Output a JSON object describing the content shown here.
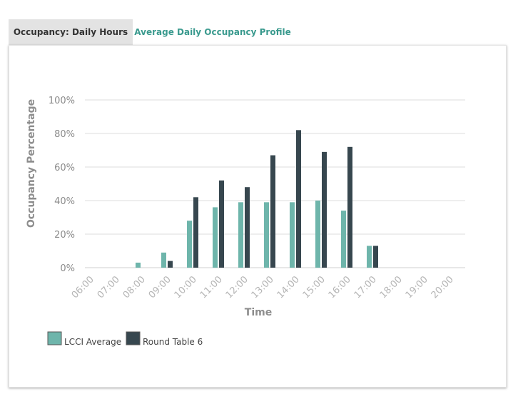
{
  "tabs": [
    {
      "label": "Occupancy: Daily Hours",
      "active": false
    },
    {
      "label": "Average Daily Occupancy Profile",
      "active": true
    }
  ],
  "colors": {
    "series_1": "#6eb5ab",
    "series_2": "#37474f",
    "grid": "#dddddd",
    "active_tab": "#3a9a8e"
  },
  "chart_data": {
    "type": "bar",
    "xlabel": "Time",
    "ylabel": "Occupancy Percentage",
    "categories": [
      "06:00",
      "07:00",
      "08:00",
      "09:00",
      "10:00",
      "11:00",
      "12:00",
      "13:00",
      "14:00",
      "15:00",
      "16:00",
      "17:00",
      "18:00",
      "19:00",
      "20:00"
    ],
    "yticks": [
      "0%",
      "20%",
      "40%",
      "60%",
      "80%",
      "100%"
    ],
    "ylim": [
      0,
      100
    ],
    "grid": true,
    "legend_position": "bottom-left",
    "series": [
      {
        "name": "LCCI Average",
        "values": [
          0,
          0,
          3,
          9,
          28,
          36,
          39,
          39,
          39,
          40,
          34,
          13,
          0,
          0,
          0
        ]
      },
      {
        "name": "Round Table 6",
        "values": [
          0,
          0,
          0,
          4,
          42,
          52,
          48,
          67,
          82,
          69,
          72,
          13,
          0,
          0,
          0
        ]
      }
    ]
  }
}
